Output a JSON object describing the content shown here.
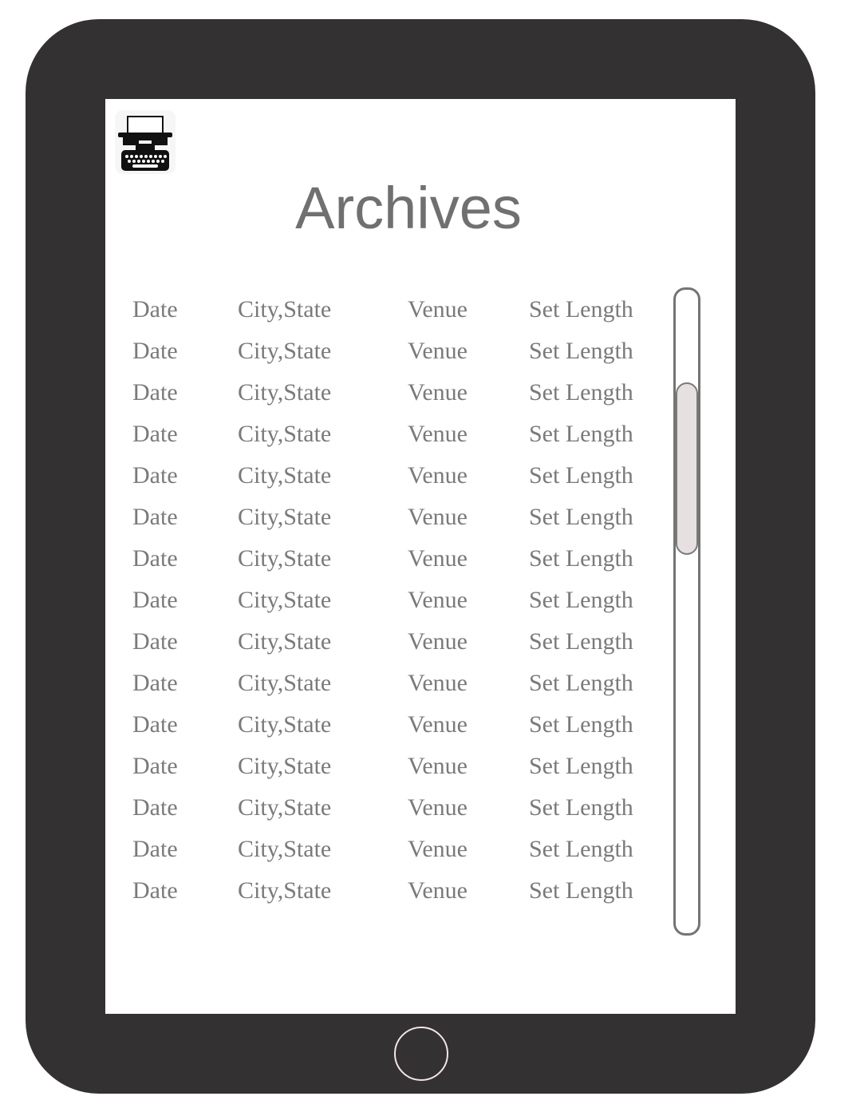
{
  "header": {
    "title": "Archives",
    "logo_icon": "typewriter-icon"
  },
  "archives": {
    "rows": [
      {
        "date": "Date",
        "city_state": "City,State",
        "venue": "Venue",
        "set_length": "Set Length"
      },
      {
        "date": "Date",
        "city_state": "City,State",
        "venue": "Venue",
        "set_length": "Set Length"
      },
      {
        "date": "Date",
        "city_state": "City,State",
        "venue": "Venue",
        "set_length": "Set Length"
      },
      {
        "date": "Date",
        "city_state": "City,State",
        "venue": "Venue",
        "set_length": "Set Length"
      },
      {
        "date": "Date",
        "city_state": "City,State",
        "venue": "Venue",
        "set_length": "Set Length"
      },
      {
        "date": "Date",
        "city_state": "City,State",
        "venue": "Venue",
        "set_length": "Set Length"
      },
      {
        "date": "Date",
        "city_state": "City,State",
        "venue": "Venue",
        "set_length": "Set Length"
      },
      {
        "date": "Date",
        "city_state": "City,State",
        "venue": "Venue",
        "set_length": "Set Length"
      },
      {
        "date": "Date",
        "city_state": "City,State",
        "venue": "Venue",
        "set_length": "Set Length"
      },
      {
        "date": "Date",
        "city_state": "City,State",
        "venue": "Venue",
        "set_length": "Set Length"
      },
      {
        "date": "Date",
        "city_state": "City,State",
        "venue": "Venue",
        "set_length": "Set Length"
      },
      {
        "date": "Date",
        "city_state": "City,State",
        "venue": "Venue",
        "set_length": "Set Length"
      },
      {
        "date": "Date",
        "city_state": "City,State",
        "venue": "Venue",
        "set_length": "Set Length"
      },
      {
        "date": "Date",
        "city_state": "City,State",
        "venue": "Venue",
        "set_length": "Set Length"
      },
      {
        "date": "Date",
        "city_state": "City,State",
        "venue": "Venue",
        "set_length": "Set Length"
      }
    ]
  },
  "scrollbar": {
    "position": 0.22
  },
  "device": {
    "home_button_icon": "home-button-icon"
  },
  "colors": {
    "device_bezel": "#333132",
    "text_gray": "#7a7a7a",
    "scroll_thumb": "#e7e0e0"
  }
}
